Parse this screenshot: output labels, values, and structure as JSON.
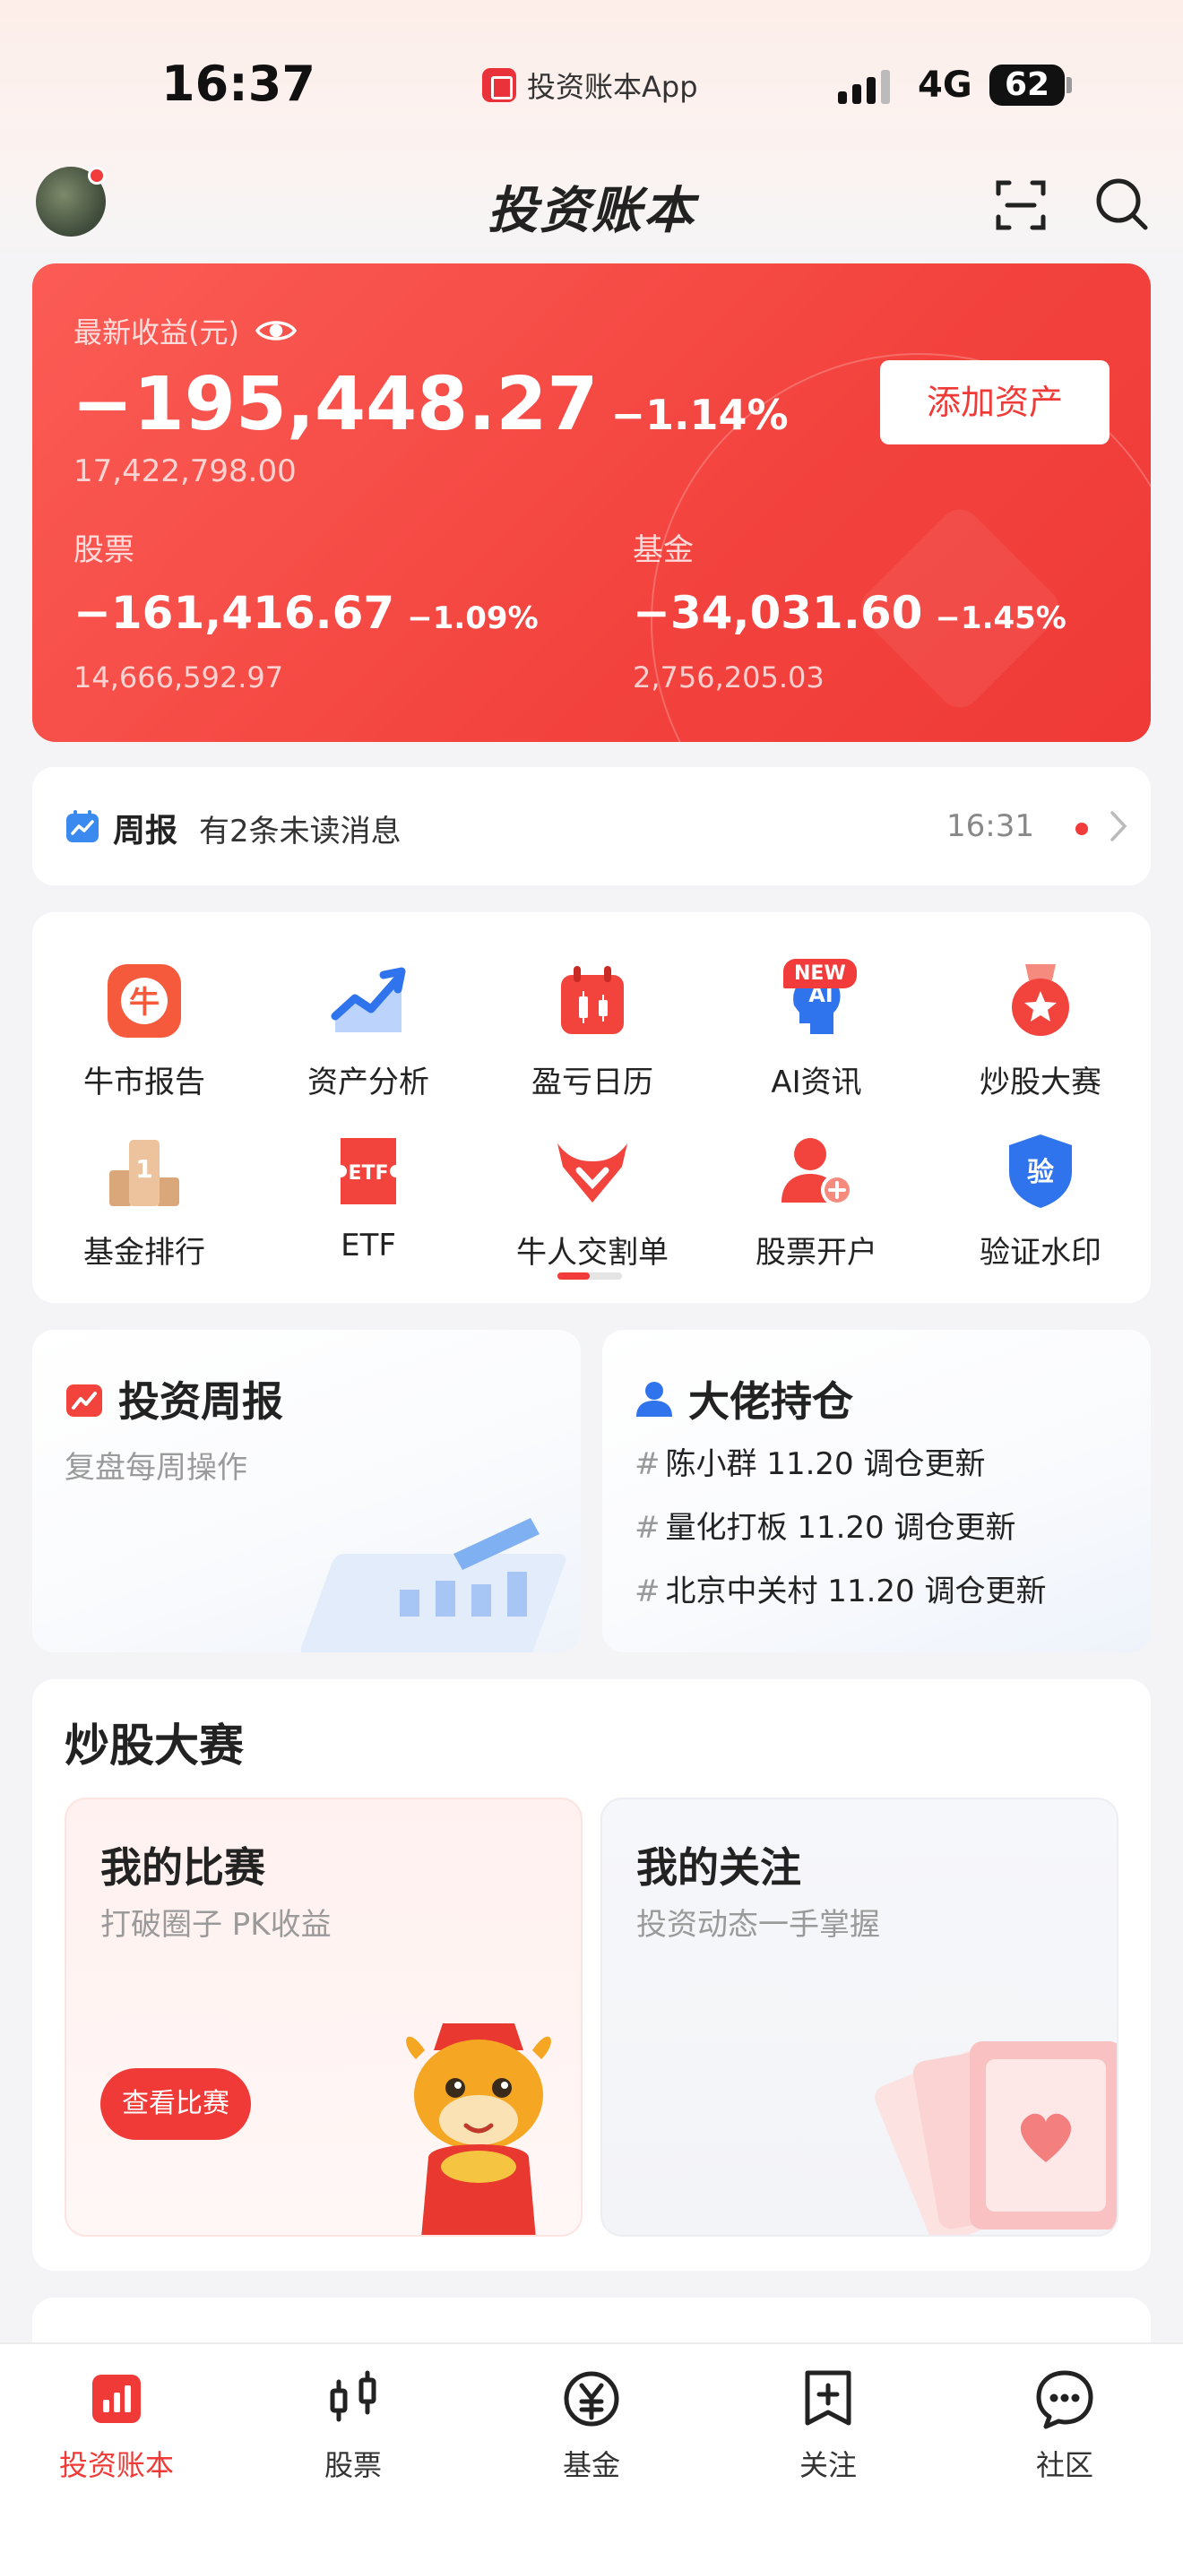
{
  "status_bar": {
    "time": "16:37",
    "app_name": "投资账本App",
    "network": "4G",
    "battery": "62"
  },
  "header": {
    "title": "投资账本"
  },
  "earnings": {
    "label": "最新收益(元)",
    "amount": "−195,448.27",
    "percent": "−1.14%",
    "total": "17,422,798.00",
    "add_button": "添加资产",
    "stocks": {
      "label": "股票",
      "amount": "−161,416.67",
      "percent": "−1.09%",
      "total": "14,666,592.97"
    },
    "funds": {
      "label": "基金",
      "amount": "−34,031.60",
      "percent": "−1.45%",
      "total": "2,756,205.03"
    }
  },
  "weekly_notice": {
    "title": "周报",
    "message": "有2条未读消息",
    "time": "16:31"
  },
  "grid": {
    "new_badge": "NEW",
    "items": [
      {
        "label": "牛市报告",
        "icon": "bull-report-icon",
        "glyph": "牛"
      },
      {
        "label": "资产分析",
        "icon": "asset-analysis-icon"
      },
      {
        "label": "盈亏日历",
        "icon": "pnl-calendar-icon"
      },
      {
        "label": "AI资讯",
        "icon": "ai-news-icon",
        "glyph": "AI"
      },
      {
        "label": "炒股大赛",
        "icon": "contest-medal-icon"
      },
      {
        "label": "基金排行",
        "icon": "fund-ranking-icon",
        "glyph": "1"
      },
      {
        "label": "ETF",
        "icon": "etf-icon",
        "glyph": "ETF"
      },
      {
        "label": "牛人交割单",
        "icon": "bull-trades-icon"
      },
      {
        "label": "股票开户",
        "icon": "open-account-icon"
      },
      {
        "label": "验证水印",
        "icon": "verify-watermark-icon",
        "glyph": "验"
      }
    ]
  },
  "weekly_report": {
    "title": "投资周报",
    "subtitle": "复盘每周操作"
  },
  "big_holdings": {
    "title": "大佬持仓",
    "items": [
      "陈小群 11.20 调仓更新",
      "量化打板 11.20 调仓更新",
      "北京中关村 11.20 调仓更新"
    ]
  },
  "contest": {
    "title": "炒股大赛",
    "my_contest": {
      "title": "我的比赛",
      "subtitle": "打破圈子 PK收益",
      "button": "查看比赛"
    },
    "my_follow": {
      "title": "我的关注",
      "subtitle": "投资动态一手掌握"
    }
  },
  "tabbar": {
    "tabs": [
      {
        "label": "投资账本",
        "icon": "ledger-icon",
        "active": true
      },
      {
        "label": "股票",
        "icon": "candlestick-icon",
        "active": false
      },
      {
        "label": "基金",
        "icon": "yuan-circle-icon",
        "active": false
      },
      {
        "label": "关注",
        "icon": "bookmark-plus-icon",
        "active": false
      },
      {
        "label": "社区",
        "icon": "chat-bubble-icon",
        "active": false
      }
    ]
  },
  "colors": {
    "accent": "#ef3a37",
    "card_gradient_start": "#fb5c55",
    "blue": "#3a7bf0"
  }
}
